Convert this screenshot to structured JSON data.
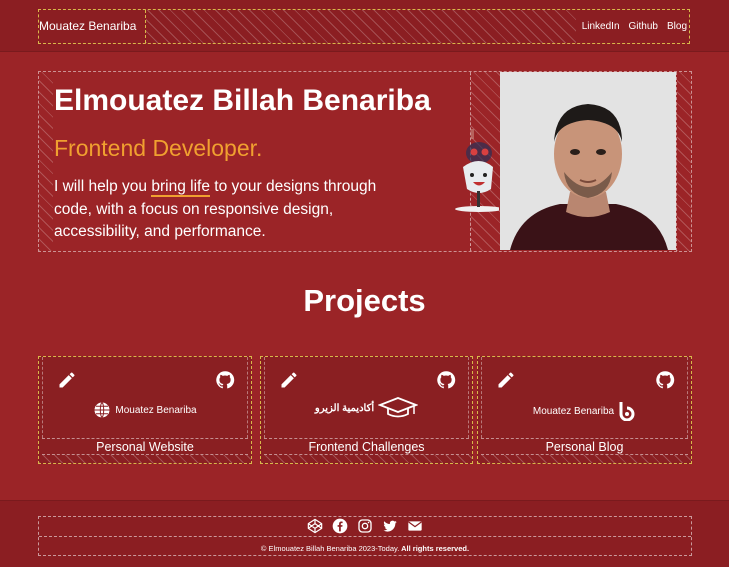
{
  "header": {
    "brand": "Mouatez Benariba",
    "nav": [
      {
        "label": "LinkedIn"
      },
      {
        "label": "Github"
      },
      {
        "label": "Blog"
      }
    ]
  },
  "hero": {
    "name": "Elmouatez Billah Benariba",
    "role": "Frontend Developer.",
    "text_before": "I will help you ",
    "text_highlight": "bring life",
    "text_after": " to your designs through code, with a focus on responsive design, accessibility, and performance."
  },
  "projects": {
    "title": "Projects",
    "cards": [
      {
        "logo_text": "Mouatez Benariba",
        "label": "Personal Website",
        "logo_icon": "globe-icon"
      },
      {
        "logo_text": "أكاديمية الزيرو",
        "label": "Frontend Challenges",
        "logo_icon": "graduation-cap-icon"
      },
      {
        "logo_text": "Mouatez Benariba",
        "label": "Personal Blog",
        "logo_icon": "blog-b-icon"
      }
    ]
  },
  "footer": {
    "copyright_prefix": "© Elmouatez Billah Benariba 2023-Today.",
    "copyright_bold": " All rights reserved.",
    "socials": [
      "codepen-icon",
      "facebook-icon",
      "instagram-icon",
      "twitter-icon",
      "email-icon"
    ]
  },
  "colors": {
    "background": "#9b2427",
    "header_bg": "#8b1e22",
    "accent": "#f0a030"
  }
}
